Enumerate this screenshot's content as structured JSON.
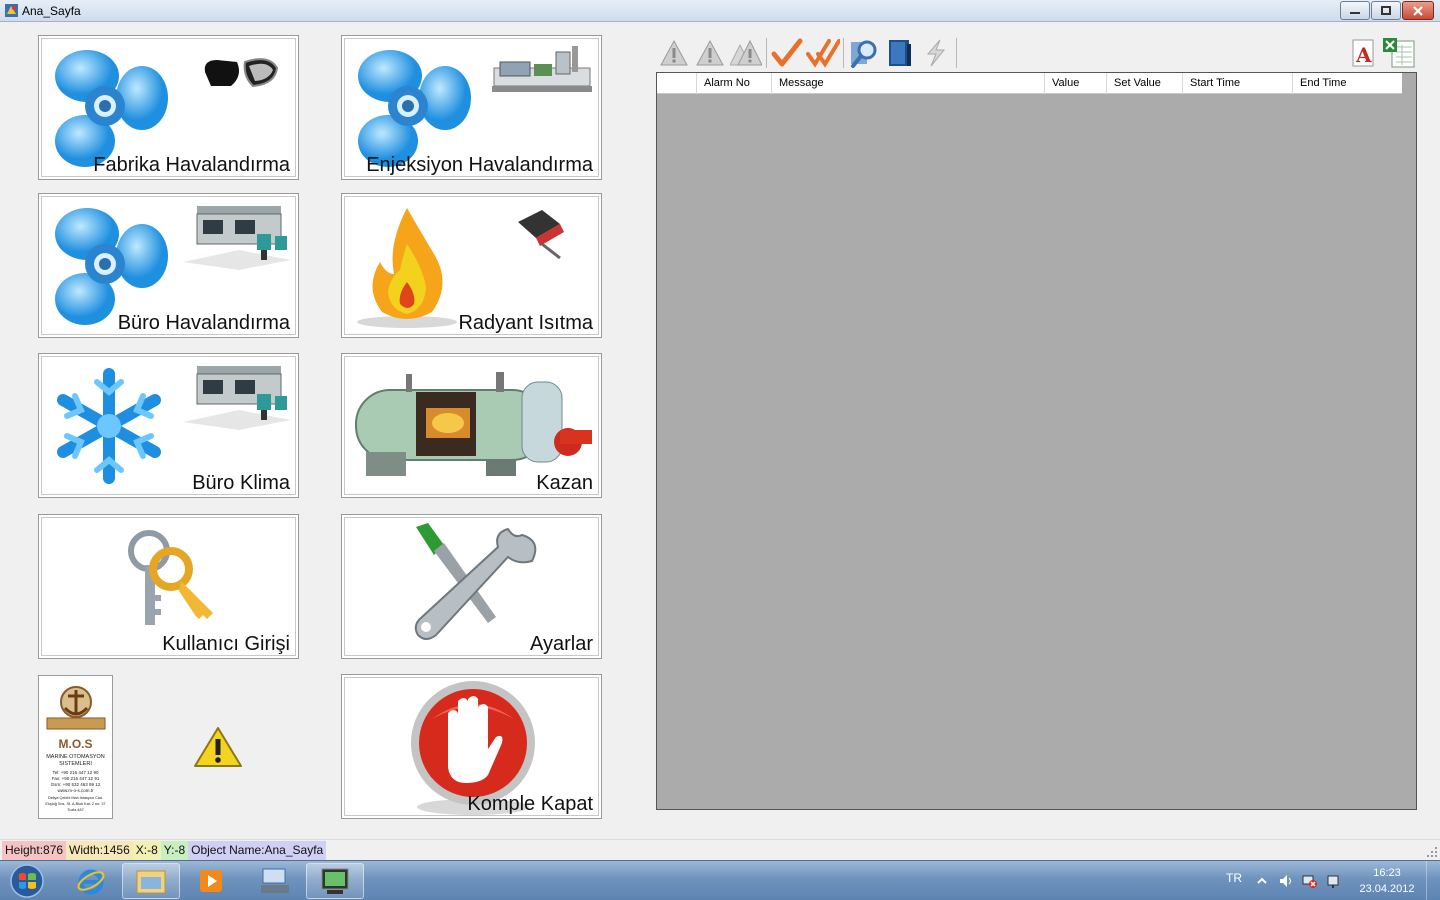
{
  "window": {
    "title": "Ana_Sayfa"
  },
  "tiles": [
    {
      "label": "Fabrika Havalandırma"
    },
    {
      "label": "Enjeksiyon Havalandırma"
    },
    {
      "label": "Büro Havalandırma"
    },
    {
      "label": "Radyant Isıtma"
    },
    {
      "label": "Büro Klima"
    },
    {
      "label": "Kazan"
    },
    {
      "label": "Kullanıcı Girişi"
    },
    {
      "label": "Ayarlar"
    },
    {
      "label": "Komple Kapat"
    }
  ],
  "logo": {
    "brand": "M.O.S",
    "company_line1": "MARINE OTOMASYON",
    "company_line2": "SISTEMLERI",
    "contact": [
      "Tel: +90 216 447 12 90",
      "Fax: +90 216 447 12 91",
      "Gsm: +90 532 463 99 12",
      "www.m-o-s.com.tr"
    ],
    "address": [
      "Deliya Çelebi Mah.Istasyon Cad.",
      "Ekşioğ Sos. St. A.Blok Kat: 2 no: 37",
      "Tuzla 487"
    ]
  },
  "toolbar": {
    "icons": [
      "alarm-warning-icon",
      "alarm-warning-icon",
      "alarm-warning-multi-icon",
      "acknowledge-check-icon",
      "acknowledge-all-check-icon",
      "search-magnifier-icon",
      "book-icon",
      "lightning-icon"
    ],
    "export_icons": [
      "pdf-export-icon",
      "excel-export-icon"
    ]
  },
  "alarm_grid": {
    "columns": [
      "",
      "Alarm No",
      "Message",
      "Value",
      "Set Value",
      "Start Time",
      "End Time"
    ],
    "rows": []
  },
  "statusbar": {
    "height": "Height:876",
    "width": "Width:1456",
    "x": "X:-8",
    "y": "Y:-8",
    "object_name": "Object Name:Ana_Sayfa"
  },
  "taskbar": {
    "language": "TR",
    "time": "16:23",
    "date": "23.04.2012"
  },
  "colors": {
    "grid_background": "#ababab",
    "status_height_bg": "#f4c3c3",
    "status_width_bg": "#f6e8b8",
    "status_x_bg": "#f3f0b4",
    "status_y_bg": "#c9eec0",
    "status_name_bg": "#cfd0f4"
  }
}
